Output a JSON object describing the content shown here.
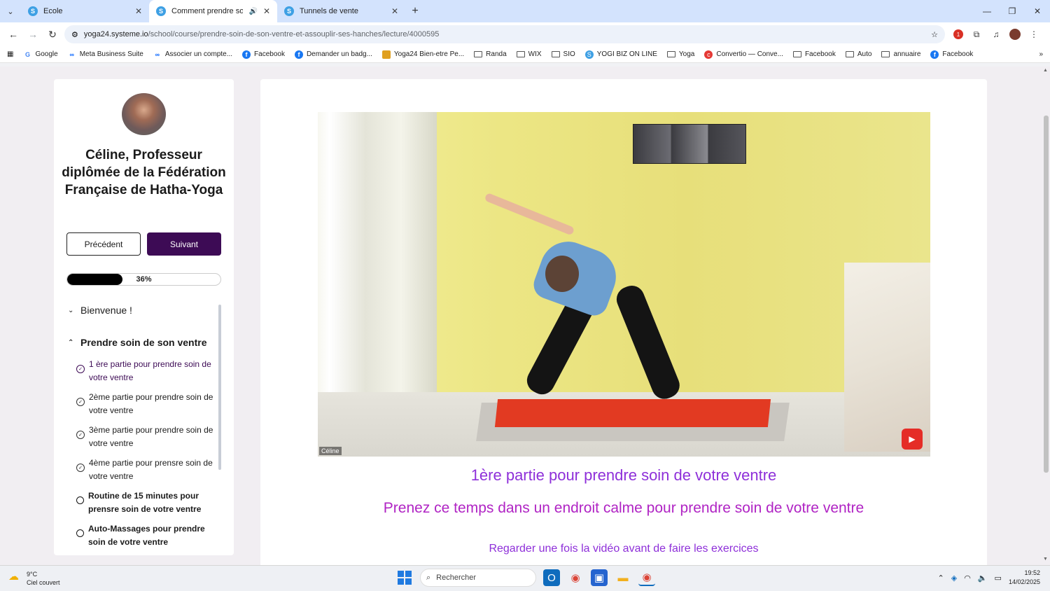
{
  "browser": {
    "tabs": [
      {
        "title": "Ecole",
        "active": false
      },
      {
        "title": "Comment prendre soin de",
        "active": true
      },
      {
        "title": "Tunnels de vente",
        "active": false
      }
    ],
    "new_tab": "+",
    "address": {
      "host": "yoga24.systeme.io",
      "path": "/school/course/prendre-soin-de-son-ventre-et-assouplir-ses-hanches/lecture/4000595"
    },
    "extension_badge": "1",
    "bookmarks": [
      {
        "label": "Google",
        "icon": "google-icon"
      },
      {
        "label": "Meta Business Suite",
        "icon": "meta-icon"
      },
      {
        "label": "Associer un compte...",
        "icon": "meta-icon"
      },
      {
        "label": "Facebook",
        "icon": "facebook-icon"
      },
      {
        "label": "Demander un badg...",
        "icon": "facebook-icon"
      },
      {
        "label": "Yoga24 Bien-etre Pe...",
        "icon": "yoga24-icon"
      },
      {
        "label": "Randa",
        "icon": "folder-icon"
      },
      {
        "label": "WIX",
        "icon": "folder-icon"
      },
      {
        "label": "SIO",
        "icon": "folder-icon"
      },
      {
        "label": "YOGI BIZ ON LINE",
        "icon": "systeme-icon"
      },
      {
        "label": "Yoga",
        "icon": "folder-icon"
      },
      {
        "label": "Convertio — Conve...",
        "icon": "convertio-icon"
      },
      {
        "label": "Facebook",
        "icon": "folder-icon"
      },
      {
        "label": "Auto",
        "icon": "folder-icon"
      },
      {
        "label": "annuaire",
        "icon": "folder-icon"
      },
      {
        "label": "Facebook",
        "icon": "facebook-icon"
      }
    ]
  },
  "sidebar": {
    "instructor": "Céline, Professeur diplômée de la Fédération Française de Hatha-Yoga",
    "prev_label": "Précédent",
    "next_label": "Suivant",
    "progress": 36,
    "progress_label": "36%",
    "modules": [
      {
        "title": "Bienvenue !",
        "open": false
      },
      {
        "title": "Prendre soin de son ventre",
        "open": true
      }
    ],
    "lessons": [
      {
        "title": "1 ère partie pour prendre soin de votre ventre",
        "state": "current"
      },
      {
        "title": "2ème partie pour prendre soin de votre ventre",
        "state": "done"
      },
      {
        "title": "3ème partie pour prendre soin de votre ventre",
        "state": "done"
      },
      {
        "title": "4ème partie pour prensre soin de votre ventre",
        "state": "done"
      },
      {
        "title": "Routine de 15 minutes pour prensre soin de votre ventre",
        "state": "todo"
      },
      {
        "title": "Auto-Massages pour prendre soin de votre ventre",
        "state": "todo"
      }
    ]
  },
  "main": {
    "video_watermark": "Céline",
    "lesson_title": "1ère partie pour prendre soin de votre ventre",
    "subtitle": "Prenez ce temps dans un endroit calme pour prendre soin de votre ventre",
    "note": "Regarder une fois la vidéo avant de faire les exercices"
  },
  "taskbar": {
    "temperature": "9°C",
    "weather": "Ciel couvert",
    "search_placeholder": "Rechercher",
    "time": "19:52",
    "date": "14/02/2025"
  }
}
